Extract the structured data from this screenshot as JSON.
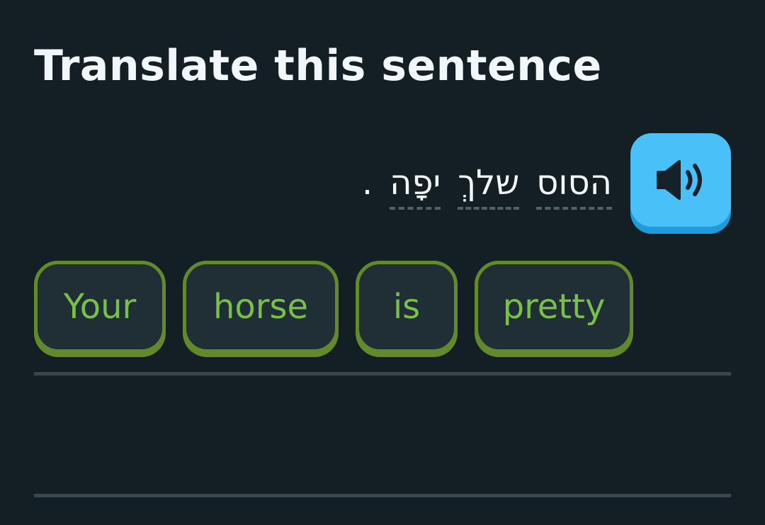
{
  "header": {
    "title": "Translate this sentence"
  },
  "prompt": {
    "words": [
      "הסוס",
      "שלךְ",
      "יפָה"
    ],
    "punctuation": ".",
    "speaker_icon": "speaker-icon"
  },
  "word_bank": [
    {
      "label": "Your"
    },
    {
      "label": "horse"
    },
    {
      "label": "is"
    },
    {
      "label": "pretty"
    }
  ],
  "colors": {
    "background": "#141f25",
    "title": "#f1f7fb",
    "speaker_button": "#49c0f8",
    "chip_border": "#628a2a",
    "chip_text": "#79c04a",
    "answer_line": "#37464f"
  }
}
